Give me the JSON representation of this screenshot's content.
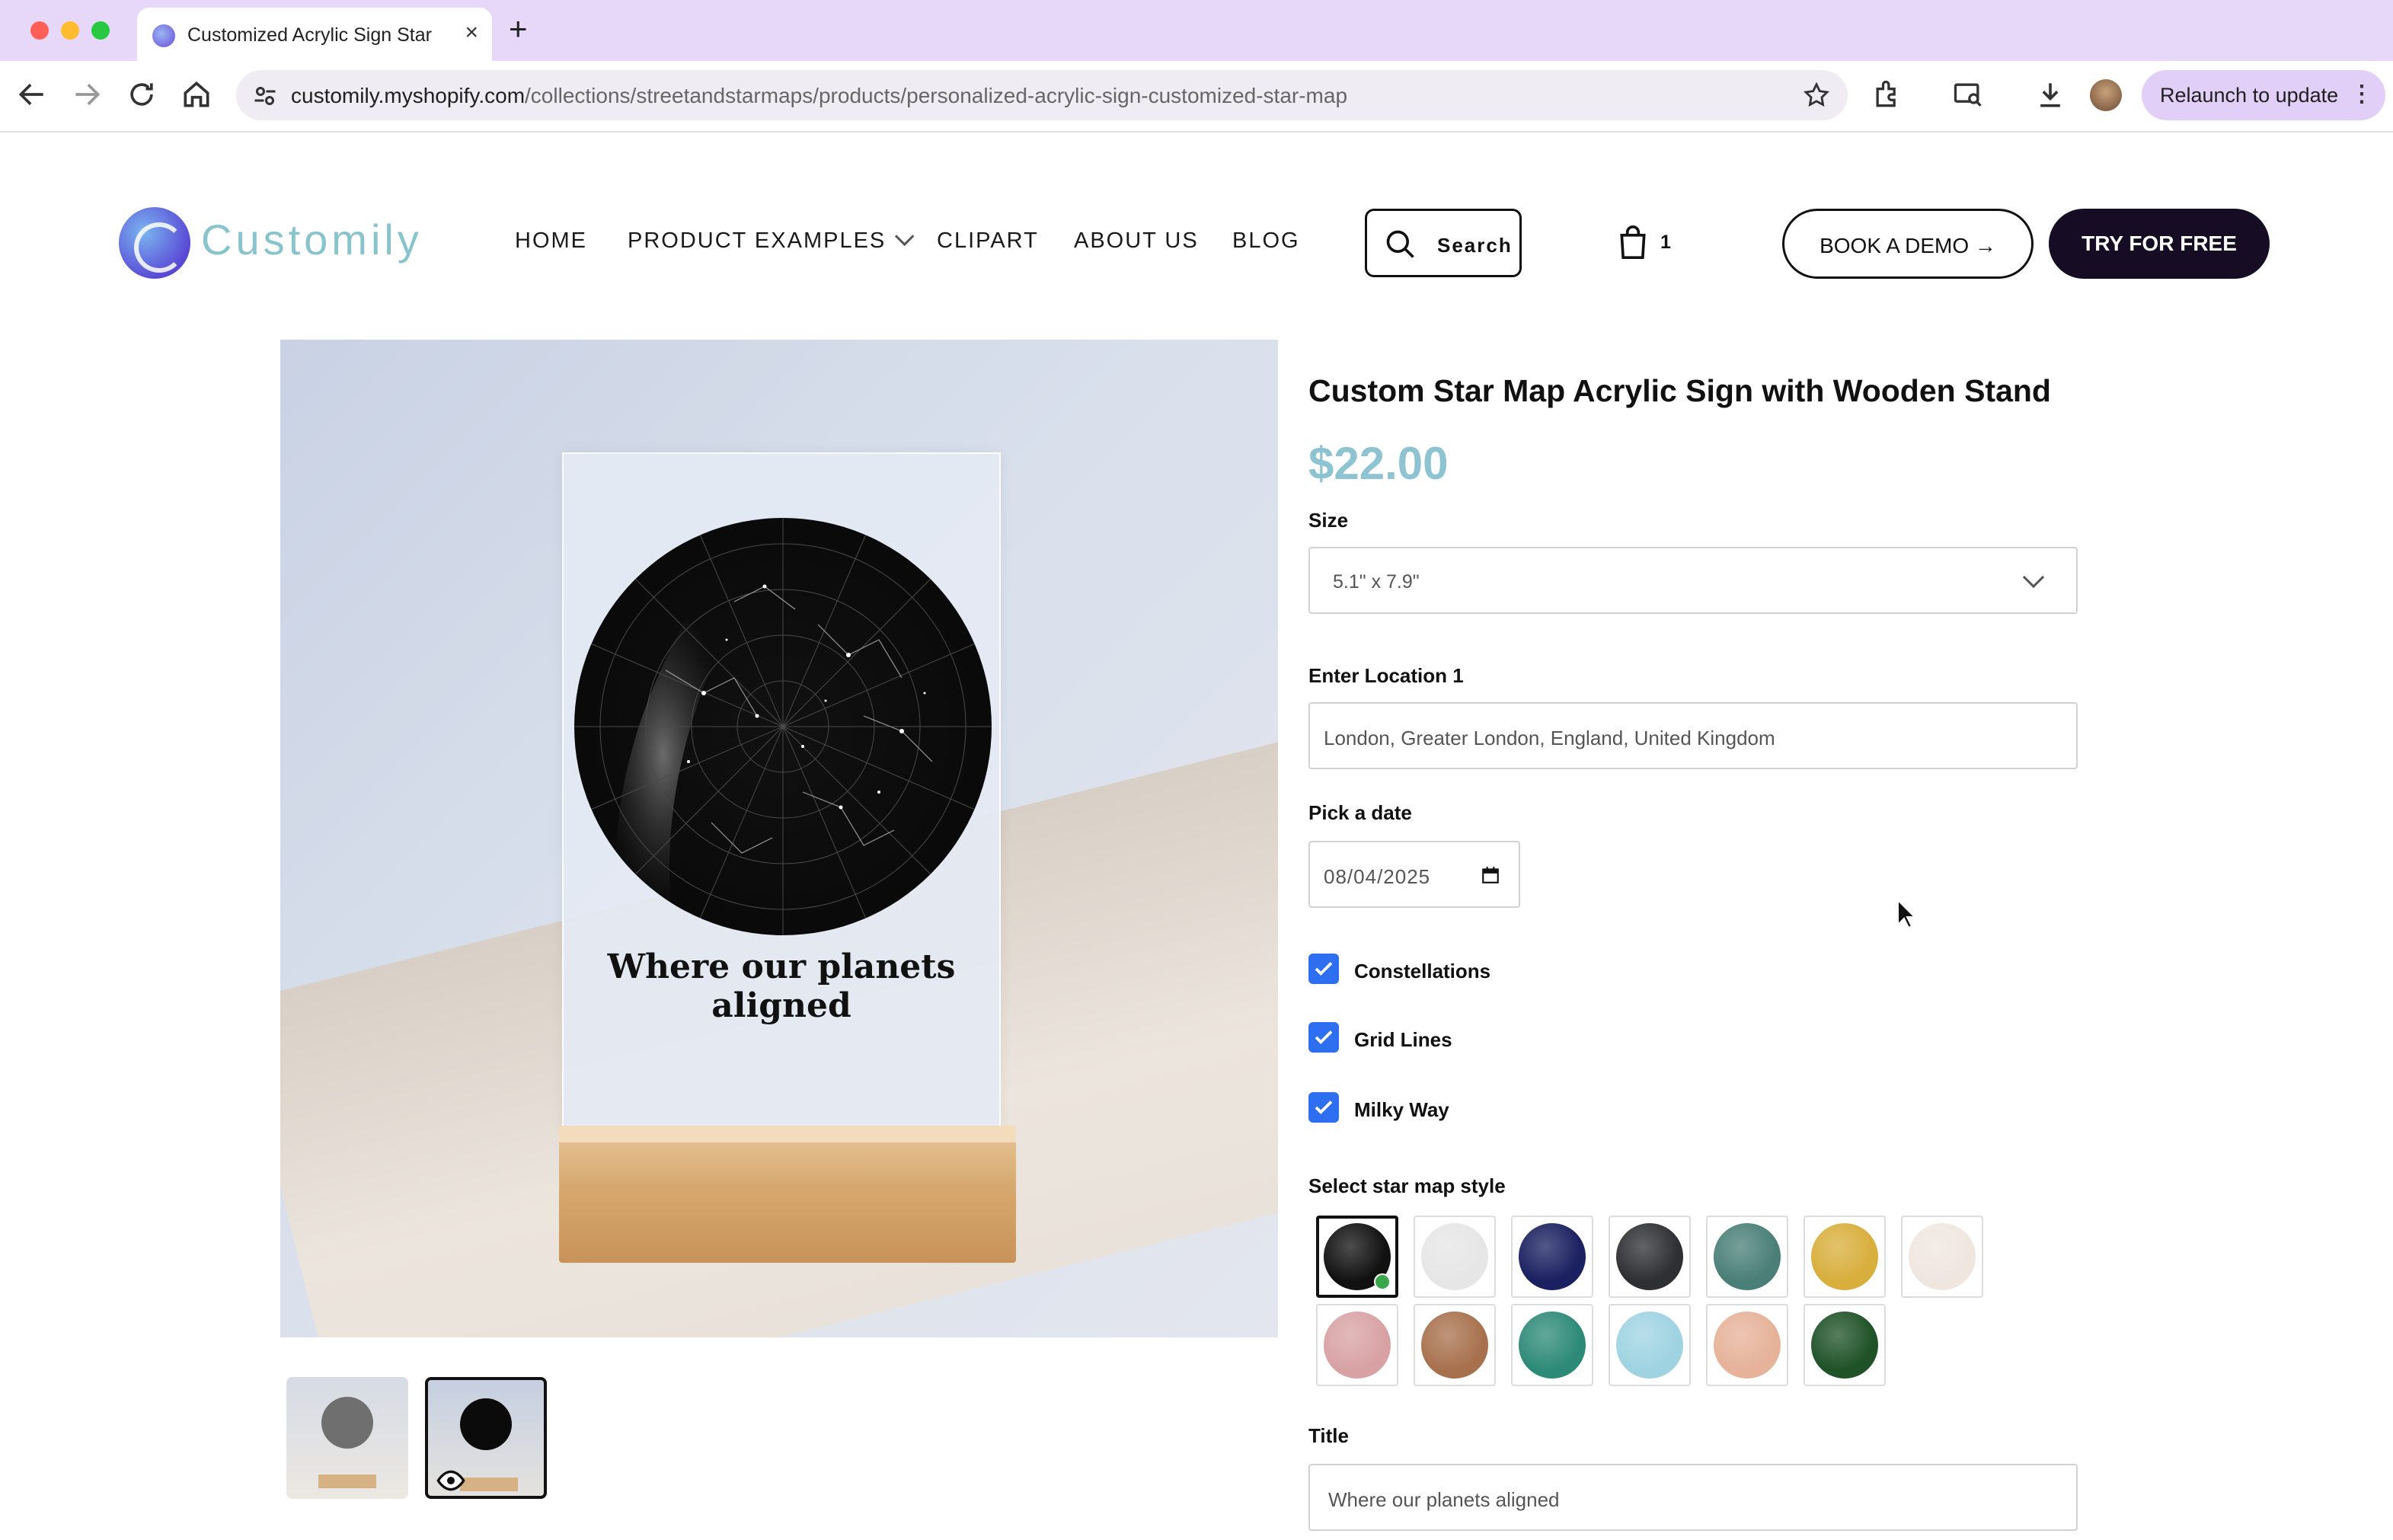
{
  "browser": {
    "tab_title": "Customized Acrylic Sign Star",
    "url_host": "customily.myshopify.com",
    "url_path": "/collections/streetandstarmaps/products/personalized-acrylic-sign-customized-star-map",
    "relaunch_label": "Relaunch to update"
  },
  "site": {
    "logo_text": "Customily",
    "nav": [
      "HOME",
      "PRODUCT EXAMPLES",
      "CLIPART",
      "ABOUT US",
      "BLOG"
    ],
    "search_label": "Search",
    "cart_count": "1",
    "demo_label": "BOOK A DEMO →",
    "try_label": "TRY FOR FREE"
  },
  "gallery": {
    "sign_title": "Where our planets aligned",
    "active_thumbnail": 2
  },
  "product": {
    "title": "Custom Star Map Acrylic Sign with Wooden Stand",
    "price": "$22.00",
    "size_label": "Size",
    "size_value": "5.1\" x 7.9\"",
    "location_label": "Enter Location 1",
    "location_value": "London, Greater London, England, United Kingdom",
    "date_label": "Pick a date",
    "date_value": "08/04/2025",
    "options": [
      {
        "label": "Constellations",
        "checked": true
      },
      {
        "label": "Grid Lines",
        "checked": true
      },
      {
        "label": "Milky Way",
        "checked": true
      }
    ],
    "style_label": "Select star map style",
    "styles": [
      {
        "color": "#111111",
        "selected": true
      },
      {
        "color": "#e6e6e6",
        "selected": false
      },
      {
        "color": "#1a2060",
        "selected": false
      },
      {
        "color": "#2e2f33",
        "selected": false
      },
      {
        "color": "#4a7f78",
        "selected": false
      },
      {
        "color": "#d8ae3c",
        "selected": false
      },
      {
        "color": "#efe6df",
        "selected": false
      },
      {
        "color": "#d8a2a4",
        "selected": false
      },
      {
        "color": "#a8714e",
        "selected": false
      },
      {
        "color": "#2e8a78",
        "selected": false
      },
      {
        "color": "#9fd3e2",
        "selected": false
      },
      {
        "color": "#e6b299",
        "selected": false
      },
      {
        "color": "#1f5227",
        "selected": false
      }
    ],
    "title_label": "Title",
    "title_value": "Where our planets aligned"
  }
}
